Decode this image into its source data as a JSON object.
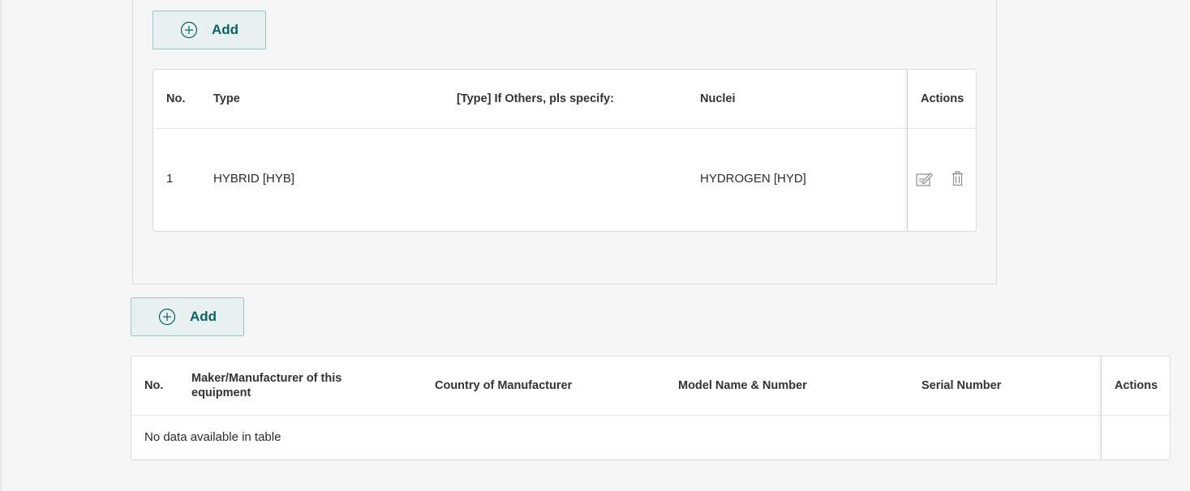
{
  "top_add_button": {
    "label": "Add",
    "icon": "plus-circle-icon"
  },
  "nuclei_table": {
    "headers": [
      "No.",
      "Type",
      "[Type] If Others, pls specify:",
      "Nuclei",
      "Actions"
    ],
    "rows": [
      {
        "no": "1",
        "type": "HYBRID [HYB]",
        "others": "",
        "nuclei": "HYDROGEN [HYD]"
      }
    ],
    "row_actions": [
      "edit-icon",
      "trash-icon"
    ]
  },
  "bottom_add_button": {
    "label": "Add",
    "icon": "plus-circle-icon"
  },
  "equipment_table": {
    "headers": [
      "No.",
      "Maker/Manufacturer of this equipment",
      "Country of Manufacturer",
      "Model Name & Number",
      "Serial Number",
      "Actions"
    ],
    "empty_message": "No data available in table"
  },
  "colors": {
    "accent": "#0f5e64",
    "button_bg": "#e7f1f1",
    "button_border": "#9cc4c6",
    "page_bg": "#f5f6f5"
  }
}
